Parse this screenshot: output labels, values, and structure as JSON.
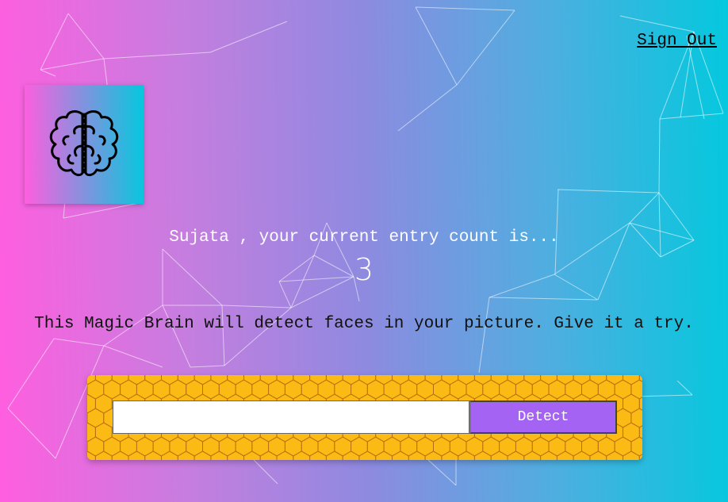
{
  "nav": {
    "sign_out_label": "Sign Out"
  },
  "logo": {
    "icon": "brain-icon"
  },
  "rank": {
    "message": "Sujata , your current entry count is...",
    "count": "3"
  },
  "intro": {
    "text": "This Magic Brain will detect faces in your picture. Give it a try."
  },
  "image_form": {
    "url_value": "",
    "url_placeholder": "",
    "detect_label": "Detect"
  },
  "colors": {
    "bg_gradient_start": "#ff5edf",
    "bg_gradient_end": "#04c8de",
    "form_background": "#fcba14",
    "hex_stroke": "#b26d10",
    "button": "#a463f2"
  }
}
